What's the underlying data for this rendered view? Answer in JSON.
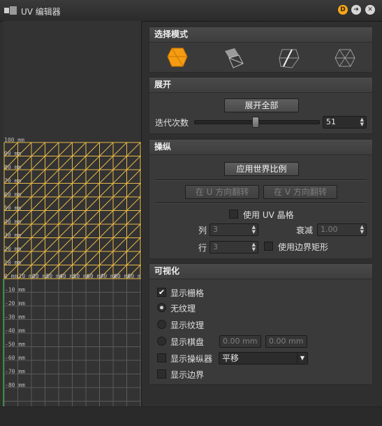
{
  "window": {
    "title": "UV 编辑器",
    "btn_d": "D",
    "btn_next": "➜",
    "btn_close": "✕"
  },
  "viewport": {
    "y_ticks_upper": [
      "100 mm",
      "90 mm",
      "80 mm",
      "70 mm",
      "60 mm",
      "50 mm",
      "40 mm",
      "30 mm",
      "20 mm",
      "10 mm",
      "0 mm"
    ],
    "x_ticks": [
      "10 mm",
      "20 mm",
      "30 mm",
      "40 mm",
      "50 mm",
      "60 mm",
      "70 mm",
      "80 mm",
      "90 mm"
    ],
    "y_ticks_lower": [
      "-10 mm",
      "-20 mm",
      "-30 mm",
      "-40 mm",
      "-50 mm",
      "-60 mm",
      "-70 mm",
      "-80 mm"
    ]
  },
  "select_mode": {
    "title": "选择模式",
    "icons": [
      "face-select-icon",
      "element-select-icon",
      "edge-select-icon",
      "vertex-select-icon"
    ]
  },
  "unwrap": {
    "title": "展开",
    "unwrap_all": "展开全部",
    "iterations_label": "迭代次数",
    "iterations_value": "51",
    "iterations_fraction": 0.49
  },
  "manipulate": {
    "title": "操纵",
    "apply_world_scale": "应用世界比例",
    "flip_u": "在 U 方向翻转",
    "flip_v": "在 V 方向翻转",
    "use_uv_lattice": "使用 UV 晶格",
    "columns_label": "列",
    "columns_value": "3",
    "falloff_label": "衰减",
    "falloff_value": "1.00",
    "rows_label": "行",
    "rows_value": "3",
    "use_bounding_rect": "使用边界矩形"
  },
  "visualize": {
    "title": "可视化",
    "show_grid": "显示栅格",
    "no_texture": "无纹理",
    "show_texture": "显示纹理",
    "show_checker": "显示棋盘",
    "checker_u": "0.00 mm",
    "checker_v": "0.00 mm",
    "show_manipulator": "显示操纵器",
    "manipulator_mode": "平移",
    "show_boundary": "显示边界"
  }
}
